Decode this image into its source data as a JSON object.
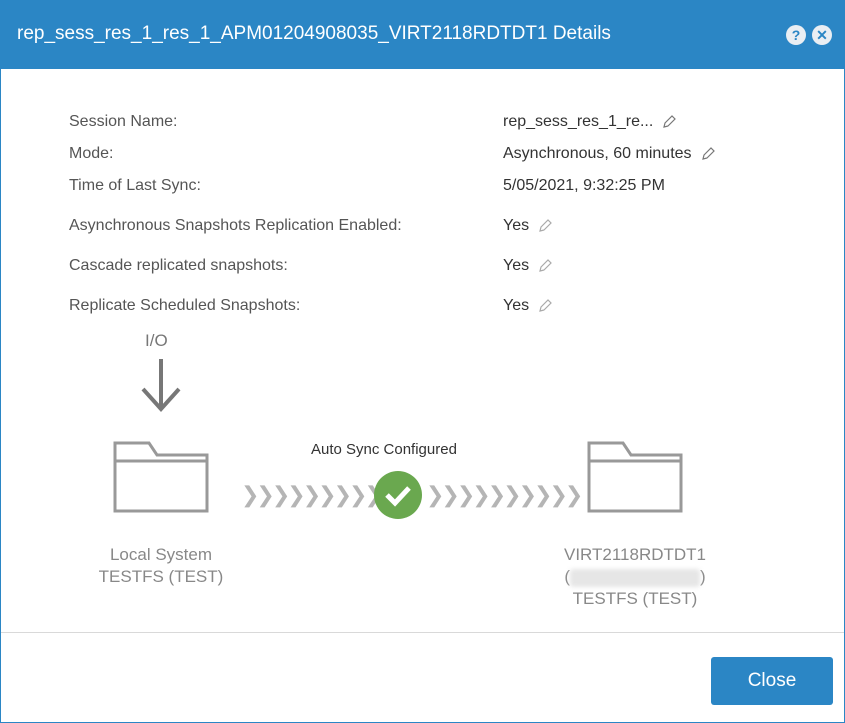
{
  "dialog": {
    "title": "rep_sess_res_1_res_1_APM01204908035_VIRT2118RDTDT1 Details",
    "help_icon": "help-icon",
    "close_icon": "close-icon"
  },
  "properties": [
    {
      "label": "Session Name:",
      "value": "rep_sess_res_1_re...",
      "editable": true
    },
    {
      "label": "Mode:",
      "value": "Asynchronous, 60 minutes",
      "editable": true
    },
    {
      "label": "Time of Last Sync:",
      "value": "5/05/2021, 9:32:25 PM",
      "editable": false
    },
    {
      "label": "Asynchronous Snapshots Replication Enabled:",
      "value": "Yes",
      "editable": true
    },
    {
      "label": "Cascade replicated snapshots:",
      "value": "Yes",
      "editable": true
    },
    {
      "label": "Replicate Scheduled Snapshots:",
      "value": "Yes",
      "editable": true
    }
  ],
  "diagram": {
    "io_label": "I/O",
    "sync_status": "Auto Sync Configured",
    "local": {
      "line1": "Local System",
      "line2": "TESTFS (TEST)"
    },
    "remote": {
      "line1": "VIRT2118RDTDT1",
      "line2_open": "(",
      "line2_close": ")",
      "line3": "TESTFS (TEST)"
    },
    "chevrons_left": "❯❯❯❯❯❯❯❯❯❯",
    "chevrons_right": "❯❯❯❯❯❯❯❯❯❯"
  },
  "footer": {
    "close_label": "Close"
  },
  "colors": {
    "accent": "#2b86c5",
    "success": "#6aa84f"
  }
}
